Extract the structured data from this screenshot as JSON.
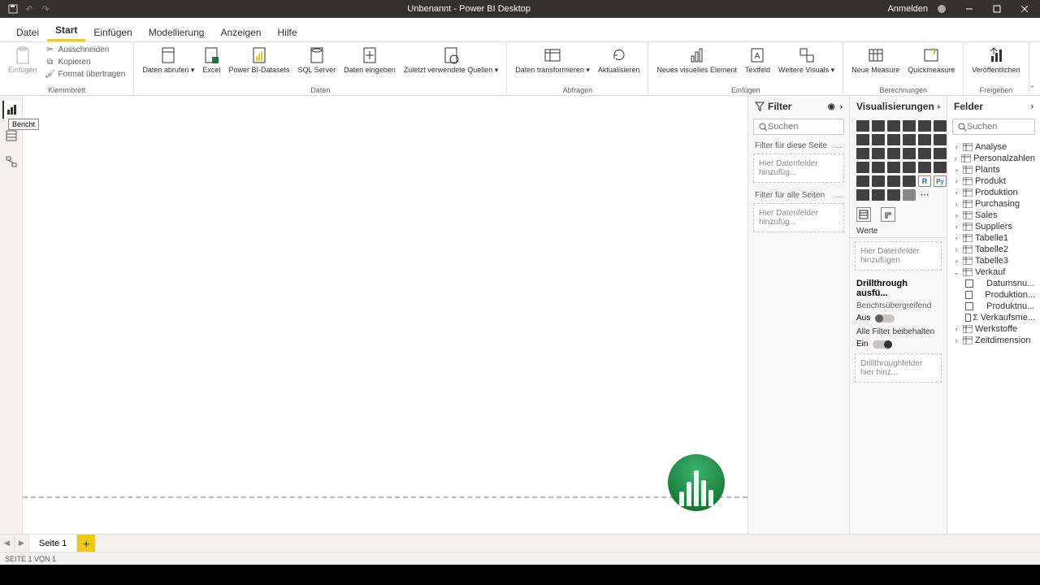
{
  "titlebar": {
    "title": "Unbenannt - Power BI Desktop",
    "signin": "Anmelden"
  },
  "menu": {
    "items": [
      "Datei",
      "Start",
      "Einfügen",
      "Modellierung",
      "Anzeigen",
      "Hilfe"
    ],
    "active": 1
  },
  "ribbon": {
    "clipboard": {
      "label": "Klemmbrett",
      "paste": "Einfügen",
      "cut": "Ausschneiden",
      "copy": "Kopieren",
      "format": "Format übertragen"
    },
    "data": {
      "label": "Daten",
      "get": "Daten abrufen ▾",
      "excel": "Excel",
      "pbids": "Power BI-Datasets",
      "sql": "SQL Server",
      "enter": "Daten eingeben",
      "recent": "Zuletzt verwendete Quellen ▾"
    },
    "queries": {
      "label": "Abfragen",
      "transform": "Daten transformieren ▾",
      "refresh": "Aktualisieren"
    },
    "insert": {
      "label": "Einfügen",
      "visual": "Neues visuelles Element",
      "textbox": "Textfeld",
      "more": "Weitere Visuals ▾"
    },
    "calc": {
      "label": "Berechnungen",
      "measure": "Neue Measure",
      "quick": "Quickmeasure"
    },
    "share": {
      "label": "Freigeben",
      "publish": "Veröffentlichen"
    }
  },
  "leftrail": {
    "tooltip": "Bericht"
  },
  "filter": {
    "header": "Filter",
    "search_ph": "Suchen",
    "page": "Filter für diese Seite",
    "allpages": "Filter für alle Seiten",
    "drop": "Hier Datenfelder hinzufüg..."
  },
  "viz": {
    "header": "Visualisierungen",
    "values": "Werte",
    "values_drop": "Hier Datenfelder hinzufügen",
    "drill_header": "Drillthrough ausfü...",
    "cross": "Berichtsübergreifend",
    "off": "Aus",
    "keep_all": "Alle Filter beibehalten",
    "on": "Ein",
    "drill_drop": "Drillthroughfelder hier hinz..."
  },
  "fields": {
    "header": "Felder",
    "search_ph": "Suchen",
    "tables": [
      {
        "name": "Analyse",
        "expanded": false
      },
      {
        "name": "Personalzahlen",
        "expanded": false
      },
      {
        "name": "Plants",
        "expanded": false
      },
      {
        "name": "Produkt",
        "expanded": false
      },
      {
        "name": "Produktion",
        "expanded": false
      },
      {
        "name": "Purchasing",
        "expanded": false
      },
      {
        "name": "Sales",
        "expanded": false
      },
      {
        "name": "Suppliers",
        "expanded": false
      },
      {
        "name": "Tabelle1",
        "expanded": false
      },
      {
        "name": "Tabelle2",
        "expanded": false
      },
      {
        "name": "Tabelle3",
        "expanded": false
      },
      {
        "name": "Verkauf",
        "expanded": true,
        "cols": [
          {
            "name": "Datumsnu...",
            "sigma": false
          },
          {
            "name": "Produktion...",
            "sigma": false
          },
          {
            "name": "Produktnu...",
            "sigma": false
          },
          {
            "name": "Verkaufsme...",
            "sigma": true
          }
        ]
      },
      {
        "name": "Werkstoffe",
        "expanded": false
      },
      {
        "name": "Zeitdimension",
        "expanded": false
      }
    ]
  },
  "pagetabs": {
    "page1": "Seite 1"
  },
  "status": {
    "text": "SEITE 1 VON 1"
  }
}
